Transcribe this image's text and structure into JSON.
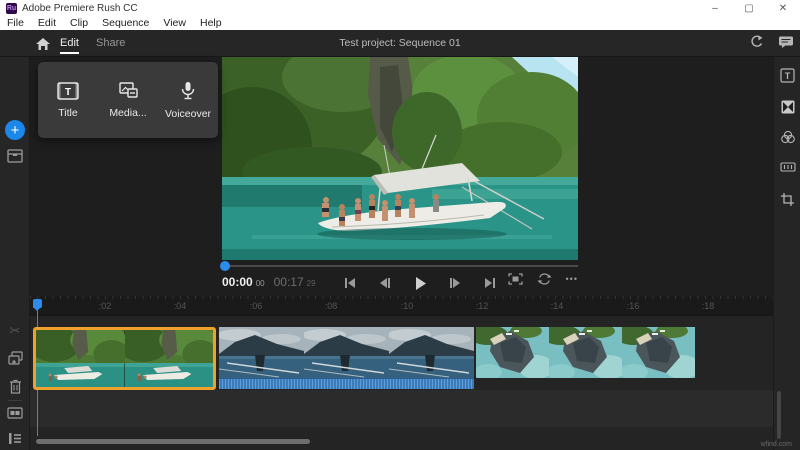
{
  "window": {
    "title": "Adobe Premiere Rush CC",
    "minimize": "–",
    "maximize": "▢",
    "close": "✕"
  },
  "menu": {
    "items": [
      "File",
      "Edit",
      "Clip",
      "Sequence",
      "View",
      "Help"
    ]
  },
  "appbar": {
    "tab_edit": "Edit",
    "tab_share": "Share",
    "project_title": "Test project: Sequence 01"
  },
  "add_popup": {
    "title_label": "Title",
    "media_label": "Media...",
    "voiceover_label": "Voiceover"
  },
  "player": {
    "current_min_sec": "00:00",
    "current_frames": "00",
    "total_min_sec": "00:17",
    "total_frames": "29",
    "more_glyph": "•••"
  },
  "timeline": {
    "ruler_labels": [
      ":02",
      ":04",
      ":06",
      ":08",
      ":10",
      ":12",
      ":14",
      ":16",
      ":18"
    ],
    "clip_count": 3
  },
  "icons": {
    "app_logo_glyph": "Ru",
    "add_glyph": "+",
    "scissors_glyph": "✂"
  },
  "colors": {
    "accent_blue": "#1b87e8",
    "playhead_blue": "#2d8ceb",
    "selection_orange": "#f0a12c",
    "waveform_blue": "#4a8fd6"
  },
  "watermark": "wfind.com"
}
